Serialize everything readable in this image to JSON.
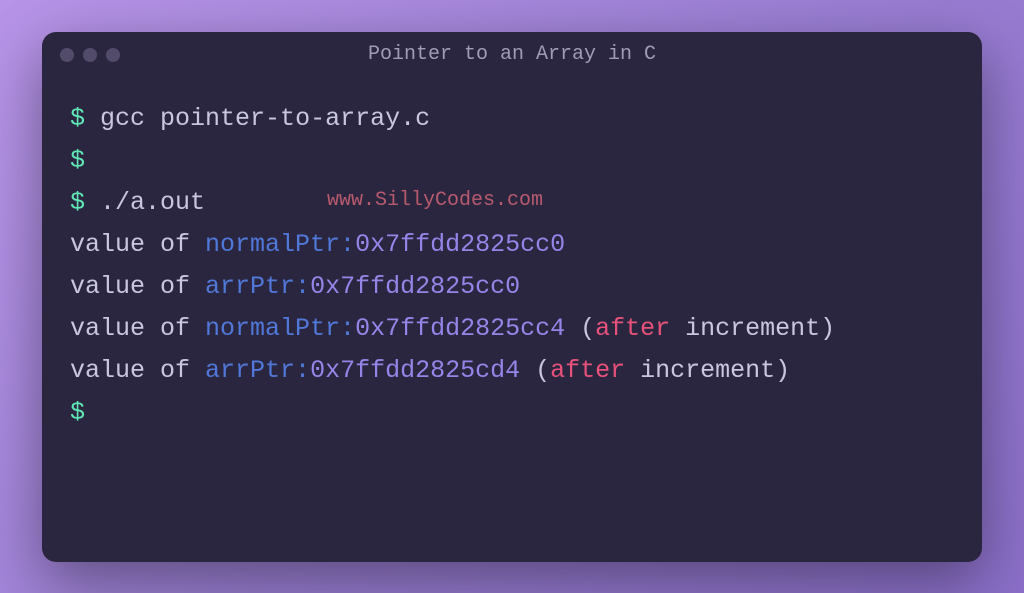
{
  "window": {
    "title": "Pointer to an Array in C"
  },
  "watermark": "www.SillyCodes.com",
  "terminal": {
    "prompt": "$",
    "lines": {
      "cmd1": "gcc pointer-to-array.c",
      "cmd2": "./a.out",
      "out1_label": "value of ",
      "out1_var": "normalPtr:",
      "out1_val": "0x7ffdd2825cc0",
      "out2_label": "value of ",
      "out2_var": "arrPtr:",
      "out2_val": "0x7ffdd2825cc0",
      "out3_label": "value of ",
      "out3_var": "normalPtr:",
      "out3_val": "0x7ffdd2825cc4",
      "out3_paren_open": " (",
      "out3_keyword": "after",
      "out3_rest": " increment)",
      "out4_label": "value of ",
      "out4_var": "arrPtr:",
      "out4_val": "0x7ffdd2825cd4",
      "out4_paren_open": " (",
      "out4_keyword": "after",
      "out4_rest": " increment)"
    }
  }
}
